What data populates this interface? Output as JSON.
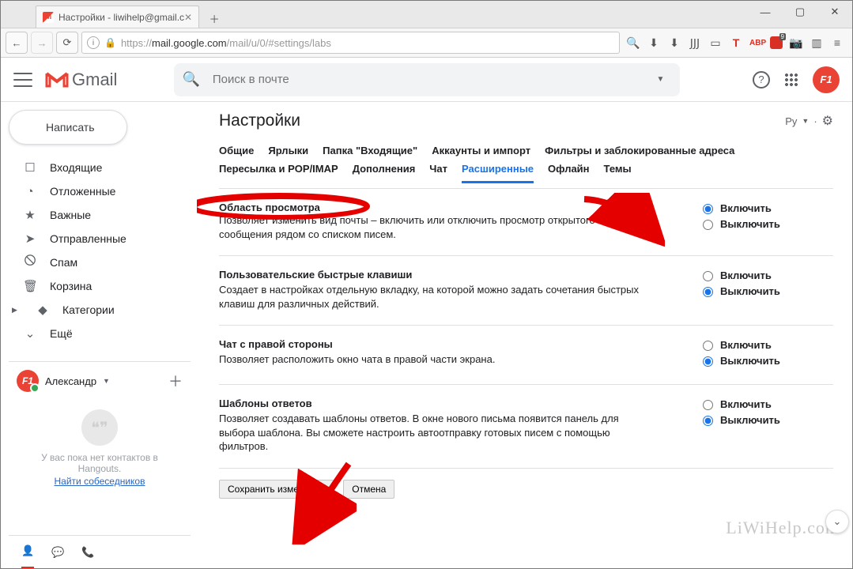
{
  "browser": {
    "tab_title": "Настройки - liwihelp@gmail.c",
    "url_prefix": "https://",
    "url_host": "mail.google.com",
    "url_path": "/mail/u/0/#settings/labs"
  },
  "header": {
    "logo_text": "Gmail",
    "search_placeholder": "Поиск в почте"
  },
  "sidebar": {
    "compose": "Написать",
    "items": [
      {
        "icon": "☐",
        "label": "Входящие"
      },
      {
        "icon": "◔",
        "label": "Отложенные"
      },
      {
        "icon": "★",
        "label": "Важные"
      },
      {
        "icon": "➤",
        "label": "Отправленные"
      },
      {
        "icon": "🛇",
        "label": "Спам"
      },
      {
        "icon": "🗑",
        "label": "Корзина"
      },
      {
        "icon": "◆",
        "label": "Категории",
        "has_caret": true
      },
      {
        "icon": "⌄",
        "label": "Ещё"
      }
    ],
    "user_name": "Александр",
    "no_contacts": "У вас пока нет контактов в Hangouts.",
    "find_link": "Найти собеседников"
  },
  "settings": {
    "page_title": "Настройки",
    "lang_label": "Ру",
    "tabs_row1": [
      "Общие",
      "Ярлыки",
      "Папка \"Входящие\"",
      "Аккаунты и импорт",
      "Фильтры и заблокированные адреса"
    ],
    "tabs_row2": [
      "Пересылка и POP/IMAP",
      "Дополнения",
      "Чат",
      "Расширенные",
      "Офлайн",
      "Темы"
    ],
    "active_tab": "Расширенные",
    "options_on": "Включить",
    "options_off": "Выключить",
    "rows": [
      {
        "title": "Область просмотра",
        "desc": "Позволяет изменить вид почты – включить или отключить просмотр открытого сообщения рядом со списком писем.",
        "value": "on"
      },
      {
        "title": "Пользовательские быстрые клавиши",
        "desc": "Создает в настройках отдельную вкладку, на которой можно задать сочетания быстрых клавиш для различных действий.",
        "value": "off"
      },
      {
        "title": "Чат с правой стороны",
        "desc": "Позволяет расположить окно чата в правой части экрана.",
        "value": "off"
      },
      {
        "title": "Шаблоны ответов",
        "desc": "Позволяет создавать шаблоны ответов. В окне нового письма появится панель для выбора шаблона. Вы сможете настроить автоотправку готовых писем с помощью фильтров.",
        "value": "off"
      }
    ],
    "save_btn": "Сохранить изменения",
    "cancel_btn": "Отмена"
  },
  "watermark": "LiWiHelp.com"
}
